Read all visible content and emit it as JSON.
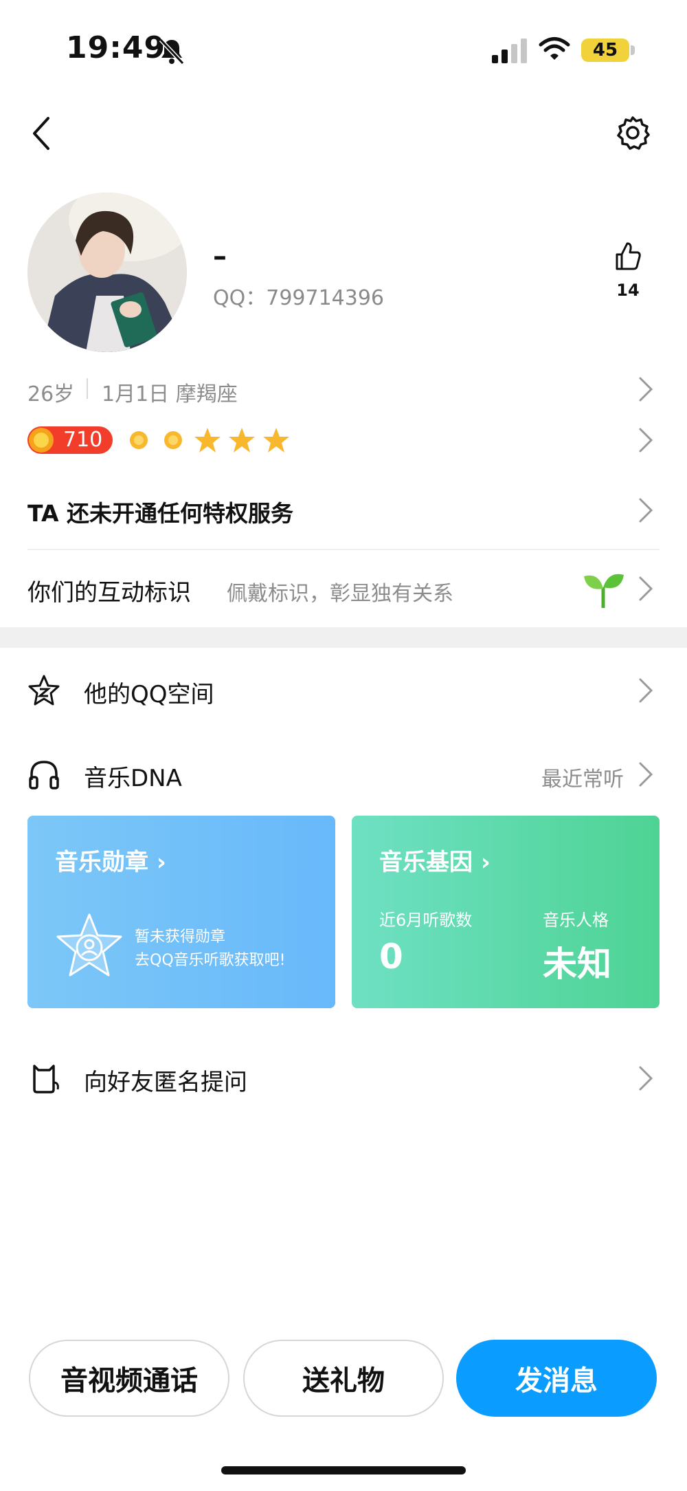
{
  "status_bar": {
    "time": "19:49",
    "battery": "45"
  },
  "profile": {
    "nickname": "–",
    "qq_label": "QQ：799714396",
    "like_count": "14"
  },
  "info": {
    "age": "26岁",
    "birthday": "1月1日 摩羯座",
    "level_value": "710"
  },
  "privilege": {
    "label": "TA 还未开通任何特权服务"
  },
  "interaction": {
    "title": "你们的互动标识",
    "subtitle": "佩戴标识，彰显独有关系"
  },
  "menu": {
    "qzone": "他的QQ空间",
    "music_dna": "音乐DNA",
    "music_recent": "最近常听",
    "anon_question": "向好友匿名提问"
  },
  "music_cards": {
    "medal": {
      "title": "音乐勋章 ›",
      "line1": "暂未获得勋章",
      "line2": "去QQ音乐听歌获取吧!"
    },
    "gene": {
      "title": "音乐基因 ›",
      "listen_label": "近6月听歌数",
      "listen_value": "0",
      "persona_label": "音乐人格",
      "persona_value": "未知"
    }
  },
  "actions": {
    "call": "音视频通话",
    "gift": "送礼物",
    "message": "发消息"
  },
  "colors": {
    "primary": "#0a9cff",
    "blue_card": "#6ab9fb",
    "green_card": "#4ed394"
  }
}
